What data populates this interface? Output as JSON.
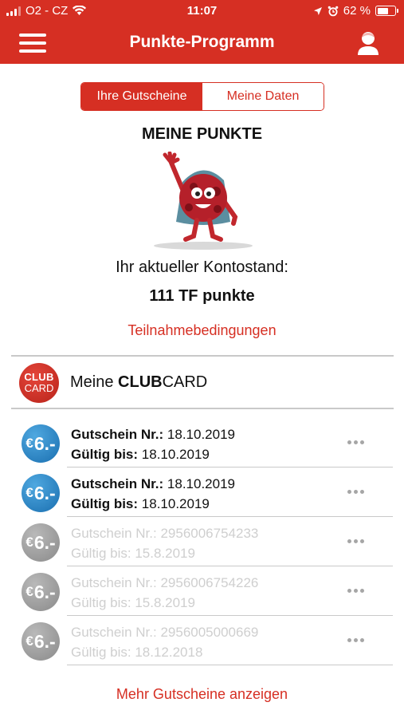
{
  "status": {
    "carrier": "O2 - CZ",
    "time": "11:07",
    "battery": "62 %",
    "battery_level": 0.62
  },
  "header": {
    "title": "Punkte-Programm",
    "menu_icon": "hamburger-menu-icon",
    "profile_icon": "user-profile-icon"
  },
  "tabs": [
    {
      "label": "Ihre Gutscheine",
      "active": true
    },
    {
      "label": "Meine Daten",
      "active": false
    }
  ],
  "points": {
    "heading": "MEINE PUNKTE",
    "balance_label": "Ihr aktueller Kontostand:",
    "balance_value": "111 TF punkte",
    "terms_link": "Teilnahmebedingungen"
  },
  "clubcard": {
    "logo_top": "CLUB",
    "logo_bottom": "CARD",
    "label_prefix": "Meine ",
    "label_bold": "CLUB",
    "label_suffix": "CARD"
  },
  "vouchers": [
    {
      "euro": "€",
      "amount": "6.-",
      "number_label": "Gutschein Nr.:",
      "number": "18.10.2019",
      "valid_label": "Gültig bis:",
      "valid": "18.10.2019",
      "state": "active"
    },
    {
      "euro": "€",
      "amount": "6.-",
      "number_label": "Gutschein Nr.:",
      "number": "18.10.2019",
      "valid_label": "Gültig bis:",
      "valid": "18.10.2019",
      "state": "active"
    },
    {
      "euro": "€",
      "amount": "6.-",
      "number_label": "Gutschein Nr.:",
      "number": "2956006754233",
      "valid_label": "Gültig bis:",
      "valid": "15.8.2019",
      "state": "expired"
    },
    {
      "euro": "€",
      "amount": "6.-",
      "number_label": "Gutschein Nr.:",
      "number": "2956006754226",
      "valid_label": "Gültig bis:",
      "valid": "15.8.2019",
      "state": "expired"
    },
    {
      "euro": "€",
      "amount": "6.-",
      "number_label": "Gutschein Nr.:",
      "number": "2956005000669",
      "valid_label": "Gültig bis:",
      "valid": "18.12.2018",
      "state": "expired"
    }
  ],
  "more_link": "Mehr Gutscheine anzeigen",
  "colors": {
    "brand_red": "#d62f23",
    "coin_blue": "#1a6fb0",
    "coin_grey": "#8a8a8a",
    "divider": "#c9c9c9"
  }
}
